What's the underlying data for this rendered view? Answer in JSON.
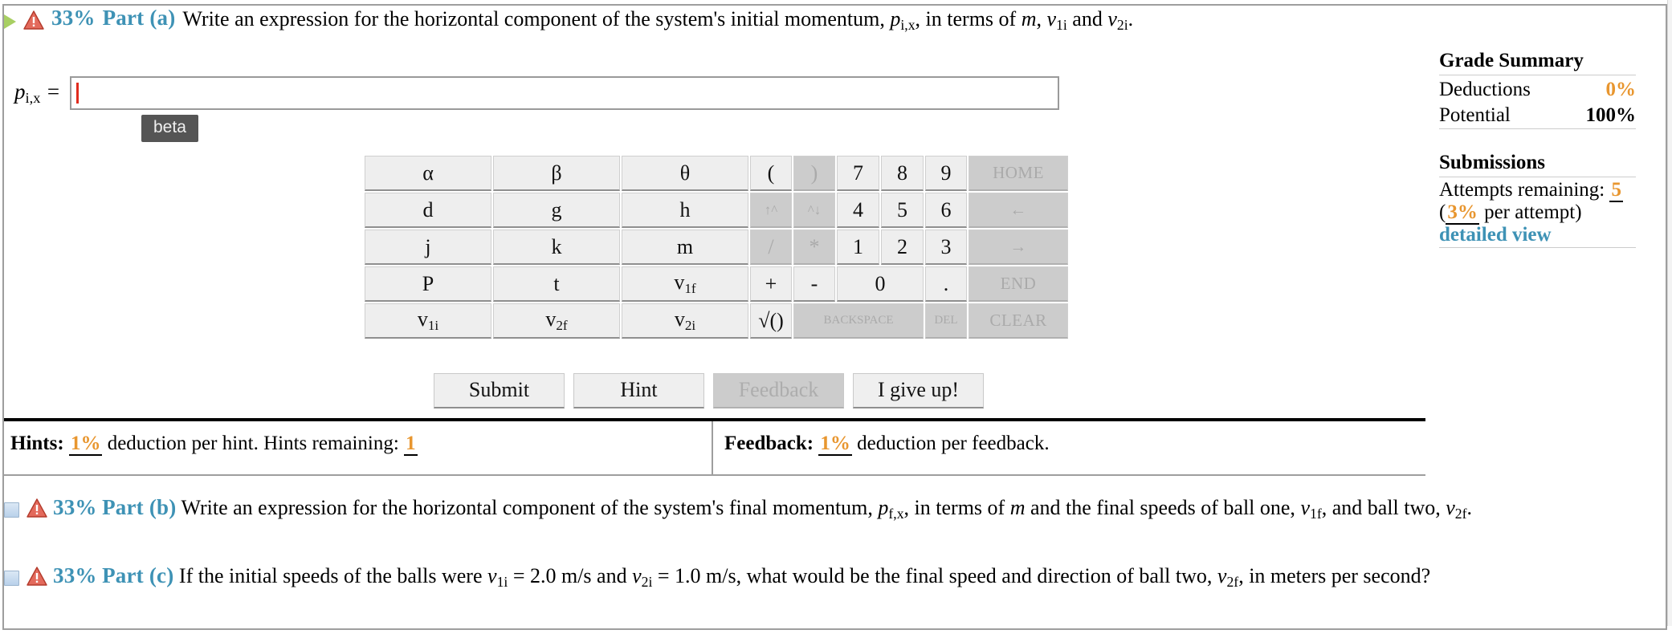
{
  "parts": [
    {
      "id": "a",
      "percent": "33%",
      "label": "Part (a)",
      "state": "open",
      "text_1": "Write an expression for the horizontal component of the system's initial momentum, ",
      "var_p": "p",
      "var_p_sub": "i,x",
      "text_2": ", in terms of ",
      "var_m": "m",
      "text_3": ", ",
      "var_v1": "v",
      "var_v1_sub": "1i",
      "text_4": " and ",
      "var_v2": "v",
      "var_v2_sub": "2i",
      "text_5": "."
    },
    {
      "id": "b",
      "percent": "33%",
      "label": "Part (b)",
      "state": "closed",
      "text_1": "Write an expression for the horizontal component of the system's final momentum, ",
      "var_p": "p",
      "var_p_sub": "f,x",
      "text_2": ", in terms of ",
      "var_m": "m",
      "text_3": " and the final speeds of ball one, ",
      "var_v1": "v",
      "var_v1_sub": "1f",
      "text_4": ", and ball two, ",
      "var_v2": "v",
      "var_v2_sub": "2f",
      "text_5": "."
    },
    {
      "id": "c",
      "percent": "33%",
      "label": "Part (c)",
      "state": "closed",
      "text_1": "If the initial speeds of the balls were ",
      "var_v1": "v",
      "var_v1_sub": "1i",
      "text_2": " = 2.0 m/s and ",
      "var_v2": "v",
      "var_v2_sub": "2i",
      "text_3": " = 1.0 m/s, what would be the final speed and direction of ball two, ",
      "var_v3": "v",
      "var_v3_sub": "2f",
      "text_4": ", in meters per second?"
    }
  ],
  "answer": {
    "label_var": "p",
    "label_sub": "i,x",
    "label_eq": " =",
    "value": "",
    "tooltip": "beta"
  },
  "keypad": {
    "rows": [
      [
        {
          "label": "α",
          "type": "sym",
          "disabled": false
        },
        {
          "label": "β",
          "type": "sym",
          "disabled": false
        },
        {
          "label": "θ",
          "type": "sym",
          "disabled": false
        },
        {
          "label": "(",
          "type": "op",
          "disabled": false
        },
        {
          "label": ")",
          "type": "op",
          "disabled": true
        },
        {
          "label": "7",
          "type": "num",
          "disabled": false
        },
        {
          "label": "8",
          "type": "num",
          "disabled": false
        },
        {
          "label": "9",
          "type": "num",
          "disabled": false
        },
        {
          "label": "HOME",
          "type": "fn",
          "disabled": true
        }
      ],
      [
        {
          "label": "d",
          "type": "sym",
          "disabled": false
        },
        {
          "label": "g",
          "type": "sym",
          "disabled": false
        },
        {
          "label": "h",
          "type": "sym",
          "disabled": false
        },
        {
          "label": "↑^",
          "type": "op",
          "disabled": true
        },
        {
          "label": "^↓",
          "type": "op",
          "disabled": true
        },
        {
          "label": "4",
          "type": "num",
          "disabled": false
        },
        {
          "label": "5",
          "type": "num",
          "disabled": false
        },
        {
          "label": "6",
          "type": "num",
          "disabled": false
        },
        {
          "label": "←",
          "type": "fn",
          "disabled": true
        }
      ],
      [
        {
          "label": "j",
          "type": "sym",
          "disabled": false
        },
        {
          "label": "k",
          "type": "sym",
          "disabled": false
        },
        {
          "label": "m",
          "type": "sym",
          "disabled": false
        },
        {
          "label": "/",
          "type": "op",
          "disabled": true
        },
        {
          "label": "*",
          "type": "op",
          "disabled": true
        },
        {
          "label": "1",
          "type": "num",
          "disabled": false
        },
        {
          "label": "2",
          "type": "num",
          "disabled": false
        },
        {
          "label": "3",
          "type": "num",
          "disabled": false
        },
        {
          "label": "→",
          "type": "fn",
          "disabled": true
        }
      ],
      [
        {
          "label": "P",
          "type": "sym",
          "disabled": false
        },
        {
          "label": "t",
          "type": "sym",
          "disabled": false
        },
        {
          "label": "v1f",
          "type": "sym",
          "disabled": false
        },
        {
          "label": "+",
          "type": "op",
          "disabled": false
        },
        {
          "label": "-",
          "type": "op",
          "disabled": false
        },
        {
          "label": "0",
          "type": "wide",
          "disabled": false
        },
        {
          "label": ".",
          "type": "num",
          "disabled": false
        },
        {
          "label": "END",
          "type": "fn",
          "disabled": true
        }
      ],
      [
        {
          "label": "v1i",
          "type": "sym",
          "disabled": false
        },
        {
          "label": "v2f",
          "type": "sym",
          "disabled": false
        },
        {
          "label": "v2i",
          "type": "sym",
          "disabled": false
        },
        {
          "label": "√()",
          "type": "op",
          "disabled": false
        },
        {
          "label": "BACKSPACE",
          "type": "wide2",
          "disabled": true
        },
        {
          "label": "DEL",
          "type": "num",
          "disabled": true
        },
        {
          "label": "CLEAR",
          "type": "fn",
          "disabled": true
        }
      ]
    ]
  },
  "actions": {
    "submit": "Submit",
    "hint": "Hint",
    "feedback": "Feedback",
    "give_up": "I give up!"
  },
  "hints_bar": {
    "hints_label": "Hints:",
    "hints_pct": "1%",
    "hints_text": "deduction per hint. Hints remaining:",
    "hints_remaining": "1",
    "feedback_label": "Feedback:",
    "feedback_pct": "1%",
    "feedback_text": "deduction per feedback."
  },
  "sidebar": {
    "grade_title": "Grade Summary",
    "deductions_label": "Deductions",
    "deductions_value": "0%",
    "potential_label": "Potential",
    "potential_value": "100%",
    "submissions_title": "Submissions",
    "attempts_label": "Attempts remaining:",
    "attempts_value": "5",
    "per_attempt_open": "(",
    "per_attempt_pct": "3%",
    "per_attempt_text": " per attempt)",
    "detailed_view": "detailed view"
  },
  "colors": {
    "accent_blue": "#3e92b5",
    "orange": "#e8962f",
    "warn_red": "#d94a3d",
    "green": "#a8cf63",
    "caret_red": "#e02b1d"
  }
}
